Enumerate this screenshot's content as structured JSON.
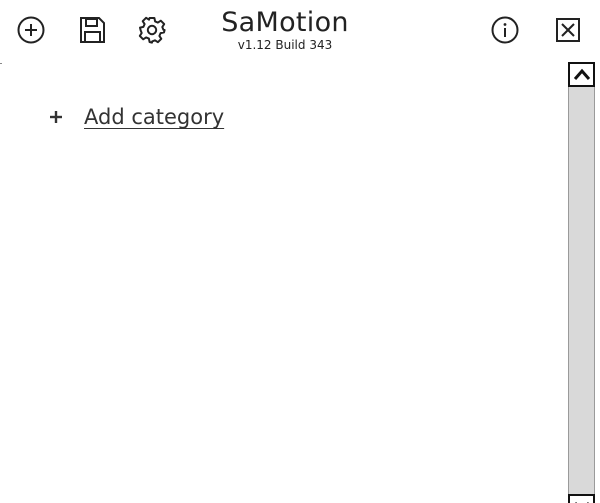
{
  "app": {
    "title": "SaMotion",
    "version": "v1.12 Build 343"
  },
  "toolbar": {
    "add_icon": "plus-circle-icon",
    "save_icon": "floppy-disk-icon",
    "settings_icon": "gear-icon",
    "info_icon": "info-circle-icon",
    "close_icon": "close-box-icon"
  },
  "content": {
    "add_category_label": "Add category",
    "add_category_icon": "plus-icon"
  },
  "scrollbar": {
    "up_icon": "chevron-up-icon",
    "down_icon": "chevron-down-icon",
    "track_color": "#d9d9d9"
  }
}
